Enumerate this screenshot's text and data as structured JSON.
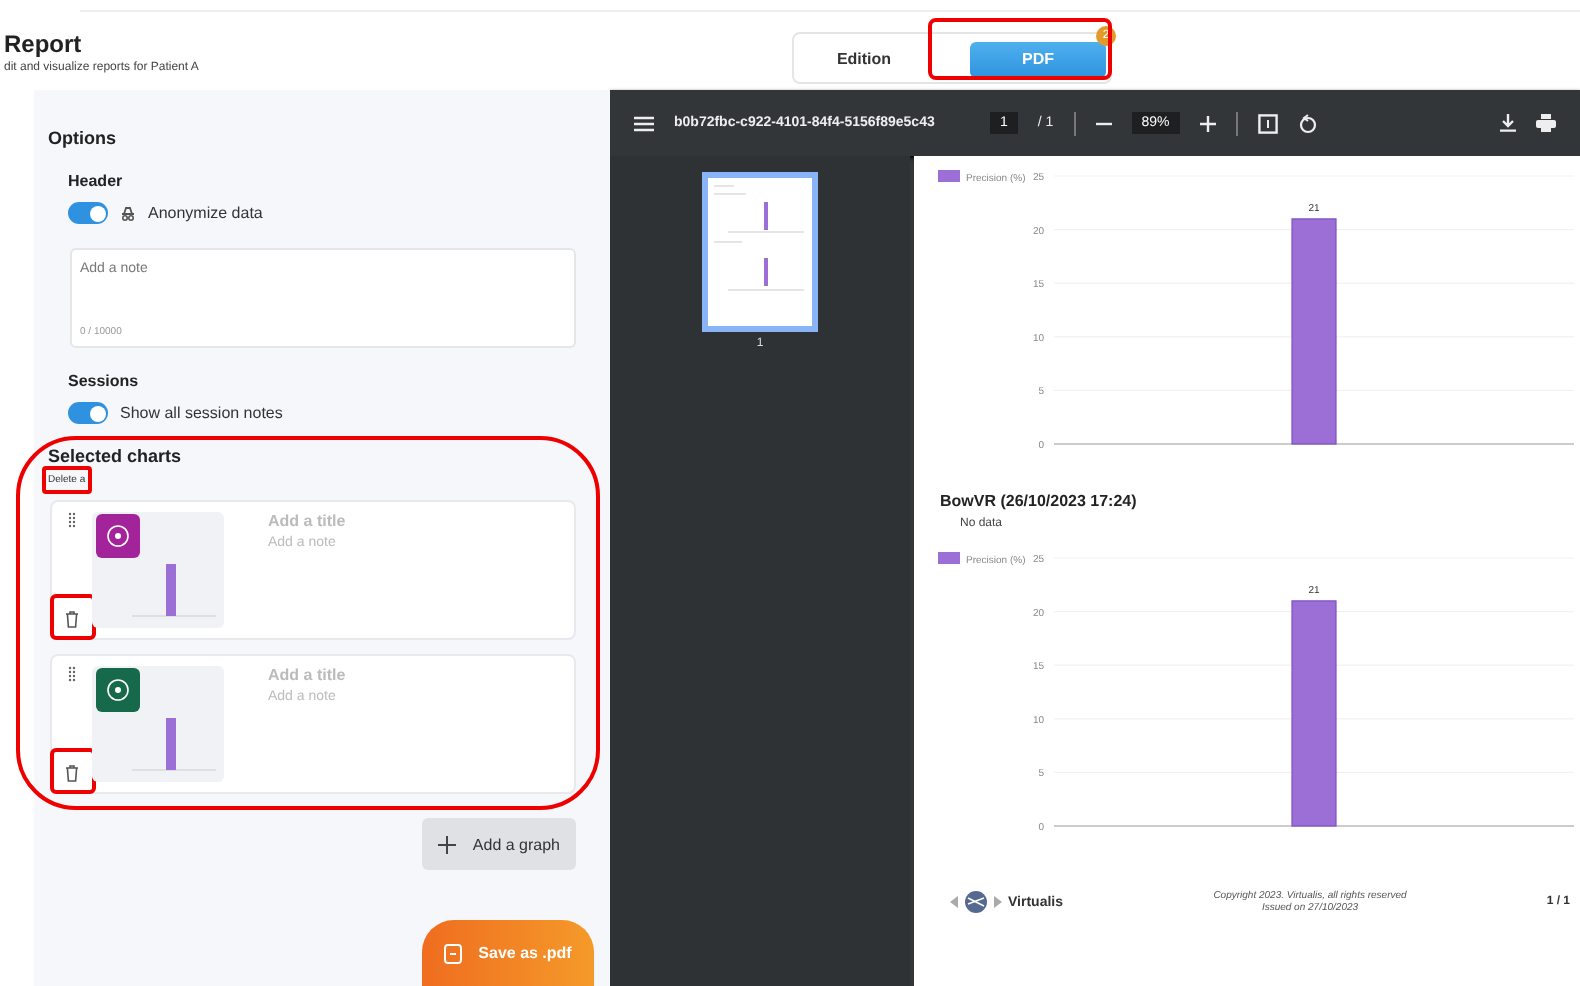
{
  "header": {
    "title": "Report",
    "subtitle": "dit and visualize reports for Patient A"
  },
  "tabs": [
    {
      "label": "Edition",
      "selected": false
    },
    {
      "label": "PDF",
      "selected": true,
      "badge": "2"
    }
  ],
  "options": {
    "title": "Options",
    "header_section": {
      "title": "Header",
      "toggle": {
        "label": "Anonymize data",
        "on": true
      }
    },
    "note": {
      "placeholder": "Add a note",
      "counter": "0 / 10000"
    },
    "sessions": {
      "title": "Sessions",
      "toggle": {
        "label": "Show all session notes",
        "on": true
      }
    }
  },
  "selected_charts": {
    "title": "Selected charts",
    "delete_all": "Delete a",
    "items": [
      {
        "title_placeholder": "Add a title",
        "note_placeholder": "Add a note",
        "color": "#a3239b"
      },
      {
        "title_placeholder": "Add a title",
        "note_placeholder": "Add a note",
        "color": "#17694b"
      }
    ]
  },
  "add_graph": "Add a graph",
  "save": "Save as .pdf",
  "viewer": {
    "filename": "b0b72fbc-c922-4101-84f4-5156f89e5c43",
    "page": "1",
    "pages": "/ 1",
    "zoom": "89%",
    "thumbnails": [
      {
        "label": "1",
        "selected": true
      }
    ],
    "sections": [
      {
        "chart_data": {
          "type": "bar",
          "series": [
            {
              "name": "Precision (%)",
              "color": "#9b6fd6",
              "values": [
                21
              ]
            }
          ],
          "ylim": [
            0,
            25
          ],
          "yticks": [
            0,
            5,
            10,
            15,
            20,
            25
          ],
          "data_labels": true,
          "grid": true
        }
      },
      {
        "title": "BowVR (26/10/2023 17:24)",
        "note": "No data",
        "chart_data": {
          "type": "bar",
          "series": [
            {
              "name": "Precision (%)",
              "color": "#9b6fd6",
              "values": [
                21
              ]
            }
          ],
          "ylim": [
            0,
            25
          ],
          "yticks": [
            0,
            5,
            10,
            15,
            20,
            25
          ],
          "data_labels": true,
          "grid": true
        }
      }
    ],
    "footer": {
      "brand": "Virtualis",
      "copyright": "Copyright 2023. Virtualis, all rights reserved",
      "issued": "Issued on 27/10/2023",
      "page": "1 / 1"
    }
  }
}
